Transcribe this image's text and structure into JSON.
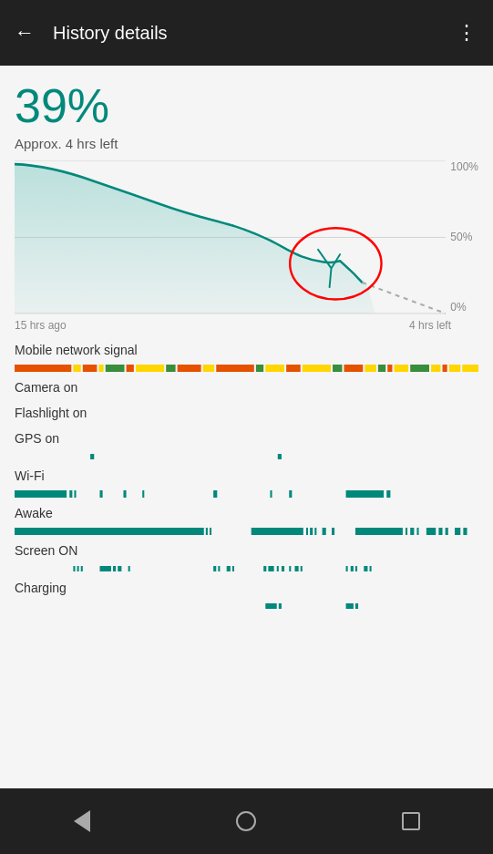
{
  "header": {
    "title": "History details",
    "back_label": "←",
    "more_label": "⋮"
  },
  "battery": {
    "percentage": "39%",
    "subtitle": "Approx. 4 hrs left"
  },
  "chart": {
    "y_labels": [
      "100%",
      "50%",
      "0%"
    ],
    "x_label_left": "15 hrs ago",
    "x_label_right": "4 hrs left"
  },
  "timelines": [
    {
      "id": "mobile-network",
      "label": "Mobile network signal",
      "has_bar": true,
      "bar_type": "mobile"
    },
    {
      "id": "camera",
      "label": "Camera on",
      "has_bar": false,
      "bar_type": "none"
    },
    {
      "id": "flashlight",
      "label": "Flashlight on",
      "has_bar": false,
      "bar_type": "none"
    },
    {
      "id": "gps",
      "label": "GPS on",
      "has_bar": true,
      "bar_type": "gps"
    },
    {
      "id": "wifi",
      "label": "Wi-Fi",
      "has_bar": true,
      "bar_type": "wifi"
    },
    {
      "id": "awake",
      "label": "Awake",
      "has_bar": true,
      "bar_type": "awake"
    },
    {
      "id": "screen",
      "label": "Screen ON",
      "has_bar": true,
      "bar_type": "screen"
    },
    {
      "id": "charging",
      "label": "Charging",
      "has_bar": true,
      "bar_type": "charging"
    }
  ],
  "nav": {
    "back_label": "back",
    "home_label": "home",
    "recent_label": "recent"
  }
}
